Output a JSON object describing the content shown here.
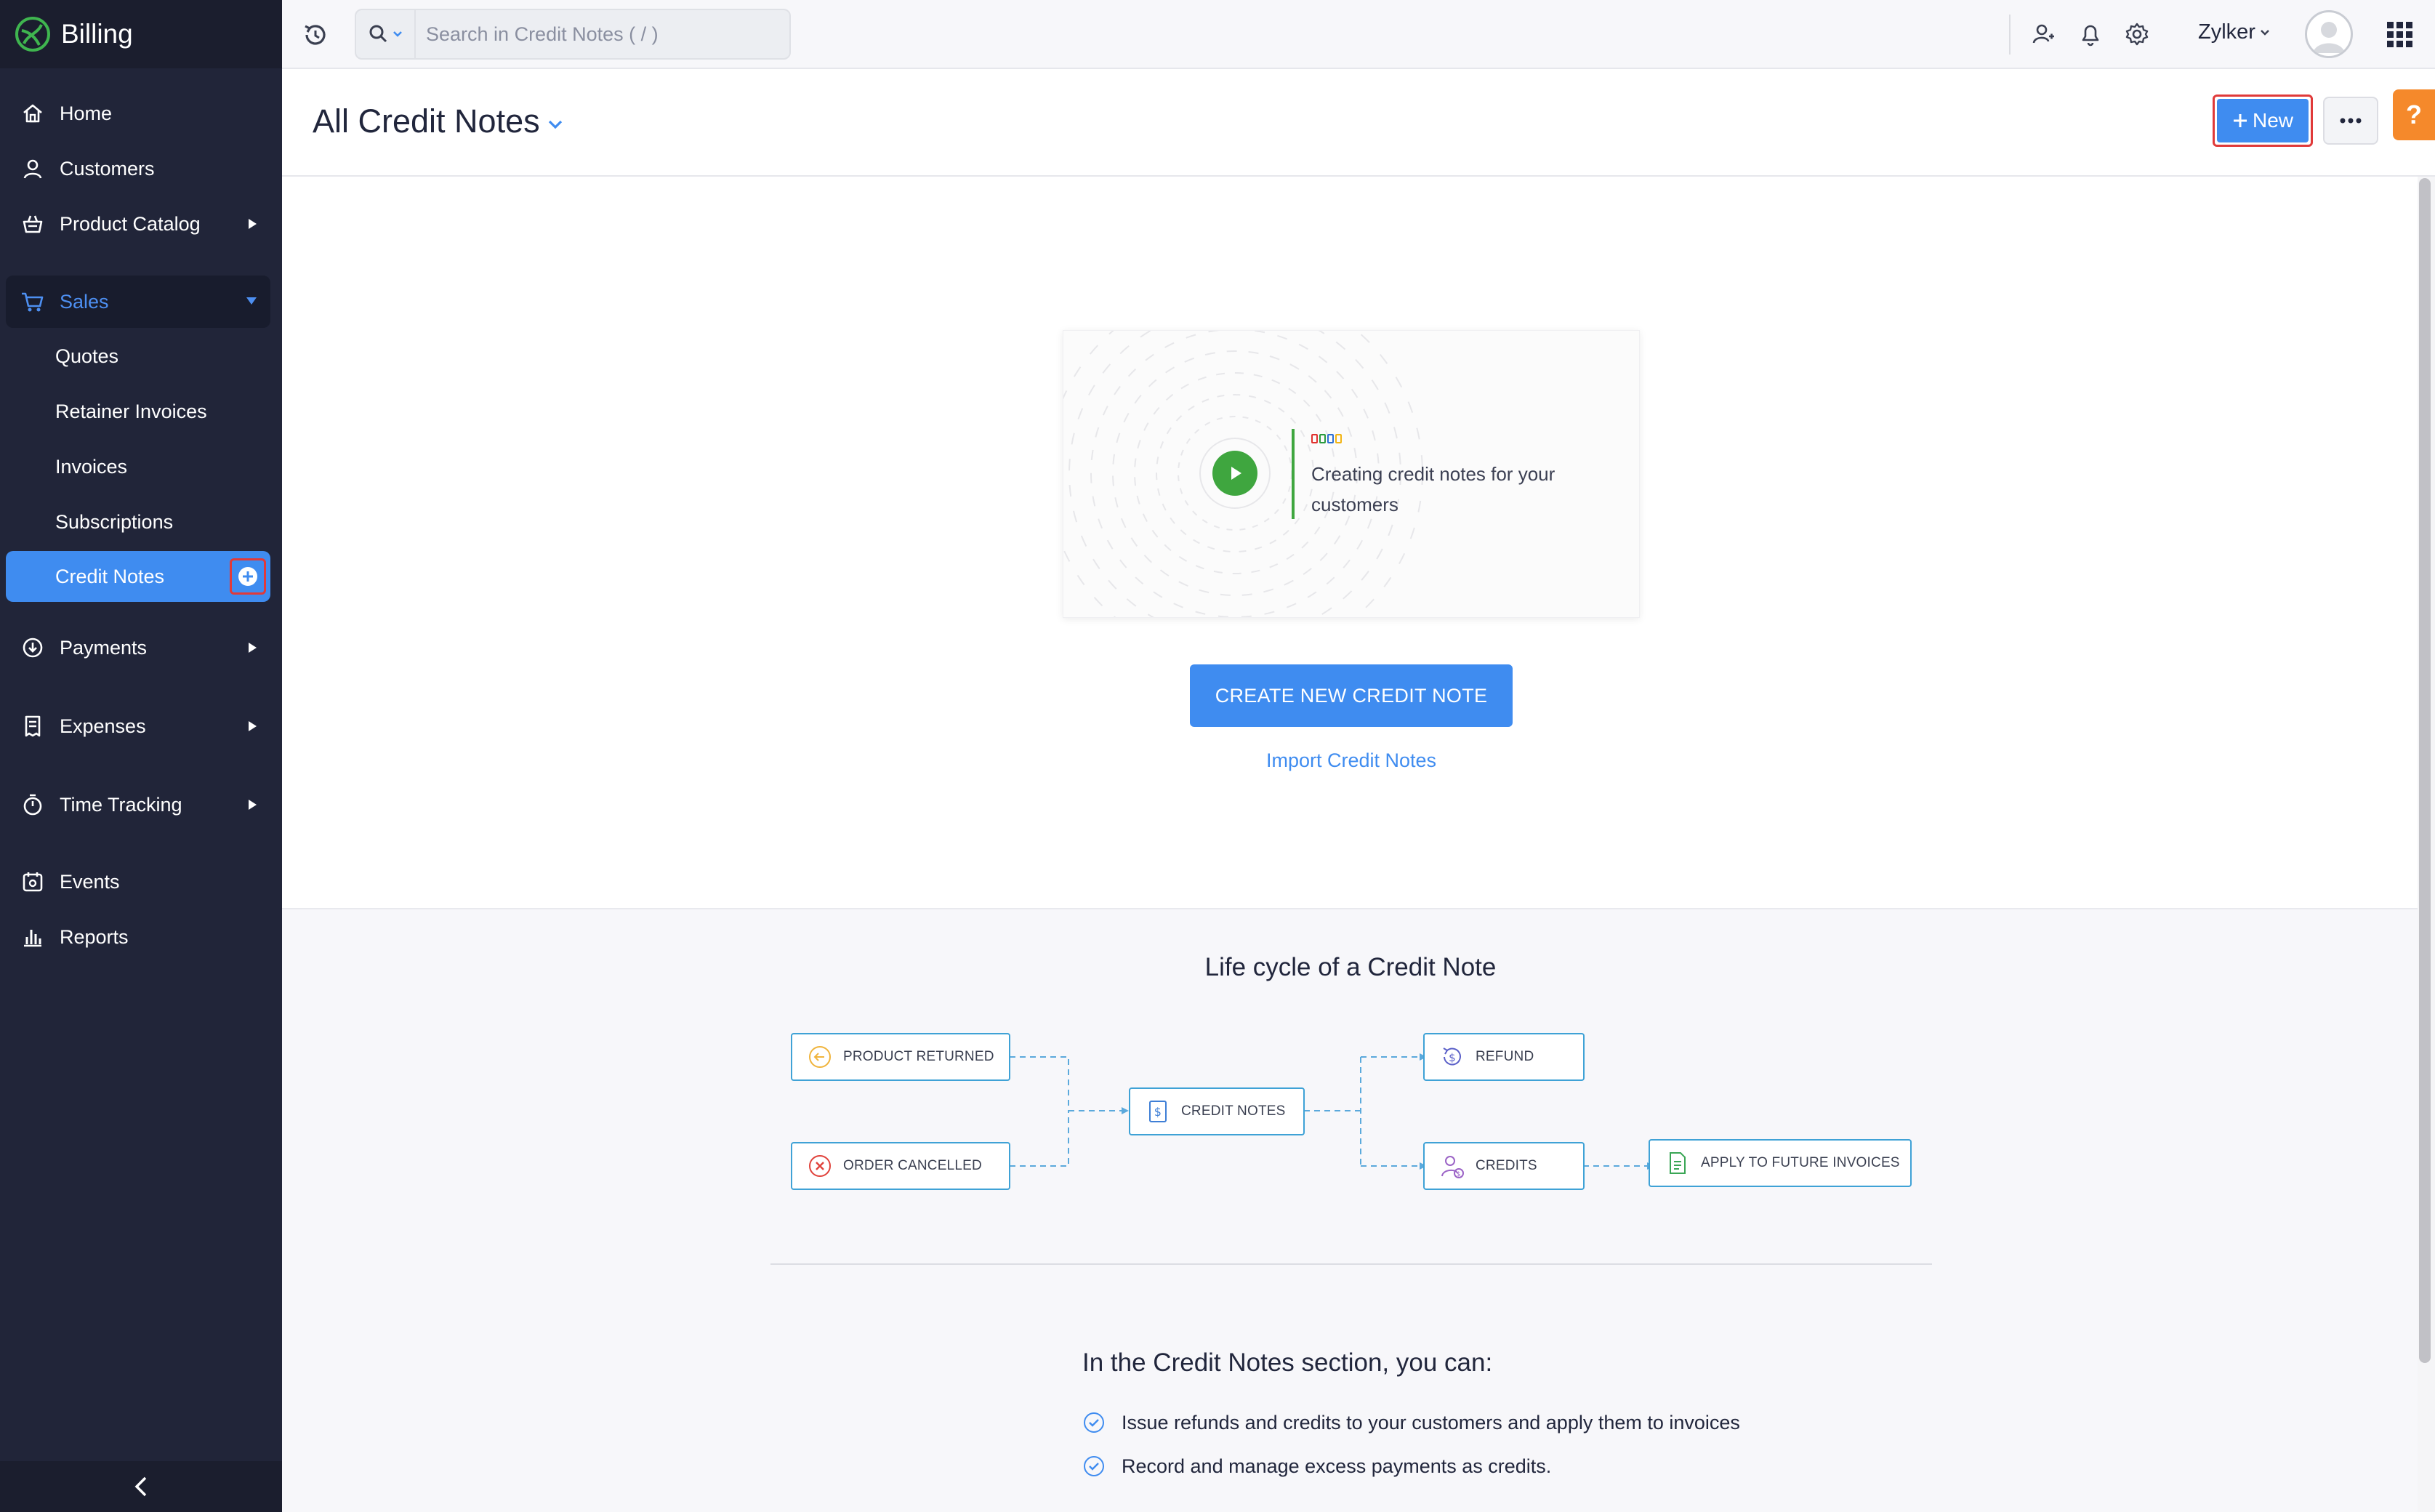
{
  "app": {
    "name": "Billing"
  },
  "sidebar": {
    "items": [
      {
        "label": "Home",
        "icon": "home-icon"
      },
      {
        "label": "Customers",
        "icon": "user-icon"
      },
      {
        "label": "Product Catalog",
        "icon": "basket-icon",
        "has_submenu": true
      },
      {
        "label": "Sales",
        "icon": "cart-icon",
        "expanded": true
      },
      {
        "label": "Payments",
        "icon": "payment-icon",
        "has_submenu": true
      },
      {
        "label": "Expenses",
        "icon": "receipt-icon",
        "has_submenu": true
      },
      {
        "label": "Time Tracking",
        "icon": "stopwatch-icon",
        "has_submenu": true
      },
      {
        "label": "Events",
        "icon": "events-icon"
      },
      {
        "label": "Reports",
        "icon": "bar-chart-icon"
      }
    ],
    "sales_subitems": [
      {
        "label": "Quotes"
      },
      {
        "label": "Retainer Invoices"
      },
      {
        "label": "Invoices"
      },
      {
        "label": "Subscriptions"
      },
      {
        "label": "Credit Notes",
        "active": true
      }
    ]
  },
  "topbar": {
    "search_placeholder": "Search in Credit Notes ( / )",
    "org_name": "Zylker"
  },
  "header": {
    "title": "All Credit Notes",
    "new_button": "New",
    "help_label": "?"
  },
  "hero": {
    "video_caption": "Creating credit notes for your customers",
    "create_button": "CREATE NEW CREDIT NOTE",
    "import_link": "Import Credit Notes"
  },
  "lifecycle": {
    "title": "Life cycle of a Credit Note",
    "steps": {
      "product_returned": "PRODUCT RETURNED",
      "order_cancelled": "ORDER CANCELLED",
      "credit_notes": "CREDIT NOTES",
      "refund": "REFUND",
      "credits": "CREDITS",
      "apply_future": "APPLY TO FUTURE INVOICES"
    }
  },
  "capabilities": {
    "title": "In the Credit Notes section, you can:",
    "items": [
      "Issue refunds and credits to your customers and apply them to invoices",
      "Record and manage excess payments as credits."
    ]
  },
  "colors": {
    "sidebar_bg": "#212539",
    "accent": "#3f8cf0",
    "highlight_border": "#e03a3a",
    "help": "#f5892b",
    "flow_border": "#3fa2d6"
  }
}
